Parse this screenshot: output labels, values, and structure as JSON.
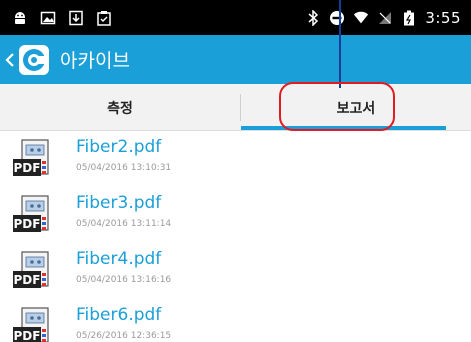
{
  "status_bar": {
    "time": "3:55",
    "left_icons": [
      "android-icon",
      "image-icon",
      "download-icon",
      "clipboard-icon"
    ],
    "right_icons": [
      "bluetooth-icon",
      "no-entry-icon",
      "wifi-icon",
      "no-signal-icon",
      "battery-icon"
    ]
  },
  "app_bar": {
    "title": "아카이브",
    "accent_color": "#1b9fd8"
  },
  "tabs": [
    {
      "label": "측정",
      "selected": false
    },
    {
      "label": "보고서",
      "selected": true
    }
  ],
  "files": [
    {
      "name": "Fiber2.pdf",
      "date": "05/04/2016 13:10:31"
    },
    {
      "name": "Fiber3.pdf",
      "date": "05/04/2016 13:11:14"
    },
    {
      "name": "Fiber4.pdf",
      "date": "05/04/2016 13:16:16"
    },
    {
      "name": "Fiber6.pdf",
      "date": "05/26/2016 12:36:15"
    }
  ],
  "file_icon_text": "PDF",
  "annotation_color": "#e21b23"
}
